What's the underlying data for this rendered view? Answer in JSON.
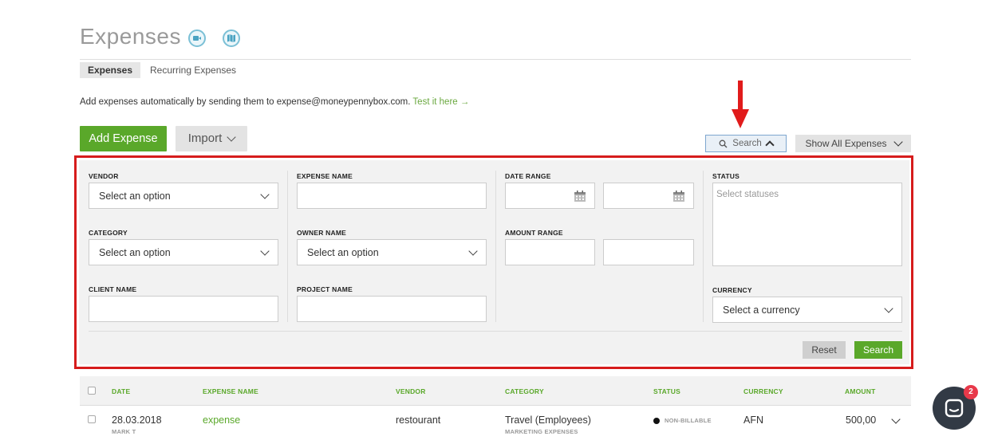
{
  "page": {
    "title": "Expenses",
    "icons": [
      "video-icon",
      "map-icon"
    ]
  },
  "tabs": [
    {
      "label": "Expenses",
      "active": true
    },
    {
      "label": "Recurring Expenses",
      "active": false
    }
  ],
  "info": {
    "text": "Add expenses automatically by sending them to expense@moneypennybox.com.",
    "link": "Test it here →"
  },
  "toolbar": {
    "add_label": "Add Expense",
    "import_label": "Import",
    "search_toggle_label": "Search",
    "show_label": "Show All Expenses"
  },
  "filters": {
    "vendor": {
      "label": "VENDOR",
      "value": "Select an option"
    },
    "category": {
      "label": "CATEGORY",
      "value": "Select an option"
    },
    "client_name": {
      "label": "CLIENT NAME",
      "value": ""
    },
    "expense_name": {
      "label": "EXPENSE NAME",
      "value": ""
    },
    "owner_name": {
      "label": "OWNER NAME",
      "value": "Select an option"
    },
    "project_name": {
      "label": "PROJECT NAME",
      "value": ""
    },
    "date_range": {
      "label": "DATE RANGE",
      "from": "",
      "to": ""
    },
    "amount_range": {
      "label": "AMOUNT RANGE",
      "min": "",
      "max": ""
    },
    "status": {
      "label": "STATUS",
      "placeholder": "Select statuses"
    },
    "currency": {
      "label": "CURRENCY",
      "value": "Select a currency"
    },
    "reset_label": "Reset",
    "search_label": "Search"
  },
  "table": {
    "columns": [
      "DATE",
      "EXPENSE NAME",
      "VENDOR",
      "CATEGORY",
      "STATUS",
      "CURRENCY",
      "AMOUNT"
    ],
    "rows": [
      {
        "date": "28.03.2018",
        "owner": "MARK T",
        "expense_name": "expense",
        "vendor": "restourant",
        "category": "Travel (Employees)",
        "category_sub": "MARKETING EXPENSES",
        "status": "NON-BILLABLE",
        "currency": "AFN",
        "amount": "500,00"
      }
    ]
  },
  "chat": {
    "badge_count": "2"
  },
  "colors": {
    "brand_green": "#5aa82a",
    "highlight_red": "#d61c1c",
    "icon_teal": "#7bc0d6"
  }
}
